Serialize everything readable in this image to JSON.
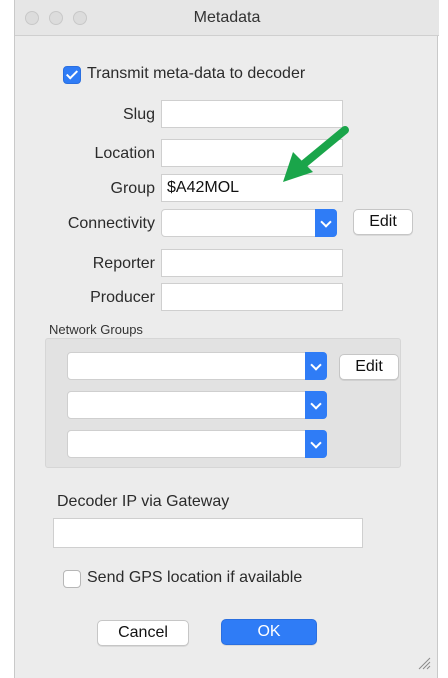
{
  "window": {
    "title": "Metadata"
  },
  "transmit": {
    "label": "Transmit meta-data to decoder",
    "checked": true
  },
  "fields": {
    "slug": {
      "label": "Slug",
      "value": ""
    },
    "location": {
      "label": "Location",
      "value": ""
    },
    "group": {
      "label": "Group",
      "value": "$A42MOL"
    },
    "connectivity": {
      "label": "Connectivity",
      "value": ""
    },
    "reporter": {
      "label": "Reporter",
      "value": ""
    },
    "producer": {
      "label": "Producer",
      "value": ""
    }
  },
  "edit_label": "Edit",
  "network_groups": {
    "label": "Network Groups",
    "edit_label": "Edit"
  },
  "decoder_ip": {
    "label": "Decoder IP via Gateway",
    "value": ""
  },
  "gps": {
    "label": "Send GPS location if available",
    "checked": false
  },
  "buttons": {
    "cancel": "Cancel",
    "ok": "OK"
  },
  "colors": {
    "accent": "#2f7cf6",
    "annotation_arrow": "#1aa54a"
  },
  "icons": [
    "check-icon",
    "chevron-down-icon",
    "resize-grip-icon",
    "green-arrow-annotation"
  ]
}
